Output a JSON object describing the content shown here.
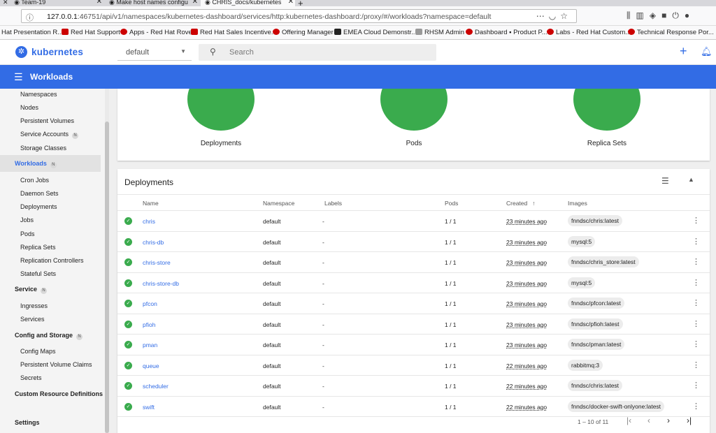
{
  "browser": {
    "tabs": [
      {
        "title": "Team-19"
      },
      {
        "title": "Make host names configu"
      },
      {
        "title": "CHRIS_docs/kubernetes"
      }
    ],
    "url_host": "127.0.0.1",
    "url_rest": ":46751/api/v1/namespaces/kubernetes-dashboard/services/http:kubernetes-dashboard:/proxy/#/workloads?namespace=default",
    "bookmarks": [
      "Hat Presentation R...",
      "Red Hat Support",
      "Apps - Red Hat Rover",
      "Red Hat Sales Incentive...",
      "Offering Manager",
      "EMEA Cloud Demonstr...",
      "RHSM Admin",
      "Dashboard ▪ Product P...",
      "Labs - Red Hat Custom...",
      "Technical Response Por..."
    ]
  },
  "header": {
    "brand": "kubernetes",
    "namespace": "default",
    "search_placeholder": "Search"
  },
  "toolbar": {
    "title": "Workloads"
  },
  "sidebar": {
    "items": [
      {
        "label": "Namespaces",
        "kind": "item"
      },
      {
        "label": "Nodes",
        "kind": "item"
      },
      {
        "label": "Persistent Volumes",
        "kind": "item"
      },
      {
        "label": "Service Accounts",
        "kind": "item",
        "badge": "N"
      },
      {
        "label": "Storage Classes",
        "kind": "item"
      },
      {
        "label": "Workloads",
        "kind": "active",
        "badge": "N"
      },
      {
        "label": "Cron Jobs",
        "kind": "item"
      },
      {
        "label": "Daemon Sets",
        "kind": "item"
      },
      {
        "label": "Deployments",
        "kind": "item"
      },
      {
        "label": "Jobs",
        "kind": "item"
      },
      {
        "label": "Pods",
        "kind": "item"
      },
      {
        "label": "Replica Sets",
        "kind": "item"
      },
      {
        "label": "Replication Controllers",
        "kind": "item"
      },
      {
        "label": "Stateful Sets",
        "kind": "item"
      },
      {
        "label": "Service",
        "kind": "group",
        "badge": "N"
      },
      {
        "label": "Ingresses",
        "kind": "item"
      },
      {
        "label": "Services",
        "kind": "item"
      },
      {
        "label": "Config and Storage",
        "kind": "group",
        "badge": "N"
      },
      {
        "label": "Config Maps",
        "kind": "item"
      },
      {
        "label": "Persistent Volume Claims",
        "kind": "item"
      },
      {
        "label": "Secrets",
        "kind": "item"
      },
      {
        "label": "Custom Resource Definitions",
        "kind": "group"
      },
      {
        "label": "Settings",
        "kind": "group"
      }
    ]
  },
  "status_cards": [
    {
      "label": "Deployments"
    },
    {
      "label": "Pods"
    },
    {
      "label": "Replica Sets"
    }
  ],
  "deployments": {
    "title": "Deployments",
    "columns": {
      "name": "Name",
      "namespace": "Namespace",
      "labels": "Labels",
      "pods": "Pods",
      "created": "Created",
      "images": "Images"
    },
    "rows": [
      {
        "name": "chris",
        "namespace": "default",
        "labels": "-",
        "pods": "1 / 1",
        "created": "23 minutes ago",
        "image": "fnndsc/chris:latest"
      },
      {
        "name": "chris-db",
        "namespace": "default",
        "labels": "-",
        "pods": "1 / 1",
        "created": "23 minutes ago",
        "image": "mysql:5"
      },
      {
        "name": "chris-store",
        "namespace": "default",
        "labels": "-",
        "pods": "1 / 1",
        "created": "23 minutes ago",
        "image": "fnndsc/chris_store:latest"
      },
      {
        "name": "chris-store-db",
        "namespace": "default",
        "labels": "-",
        "pods": "1 / 1",
        "created": "23 minutes ago",
        "image": "mysql:5"
      },
      {
        "name": "pfcon",
        "namespace": "default",
        "labels": "-",
        "pods": "1 / 1",
        "created": "23 minutes ago",
        "image": "fnndsc/pfcon:latest"
      },
      {
        "name": "pfioh",
        "namespace": "default",
        "labels": "-",
        "pods": "1 / 1",
        "created": "23 minutes ago",
        "image": "fnndsc/pfioh:latest"
      },
      {
        "name": "pman",
        "namespace": "default",
        "labels": "-",
        "pods": "1 / 1",
        "created": "23 minutes ago",
        "image": "fnndsc/pman:latest"
      },
      {
        "name": "queue",
        "namespace": "default",
        "labels": "-",
        "pods": "1 / 1",
        "created": "22 minutes ago",
        "image": "rabbitmq:3"
      },
      {
        "name": "scheduler",
        "namespace": "default",
        "labels": "-",
        "pods": "1 / 1",
        "created": "22 minutes ago",
        "image": "fnndsc/chris:latest"
      },
      {
        "name": "swift",
        "namespace": "default",
        "labels": "-",
        "pods": "1 / 1",
        "created": "22 minutes ago",
        "image": "fnndsc/docker-swift-onlyone:latest"
      }
    ],
    "pagination": "1 – 10 of 11"
  },
  "colors": {
    "accent": "#326ce5",
    "success": "#3aab4d"
  }
}
